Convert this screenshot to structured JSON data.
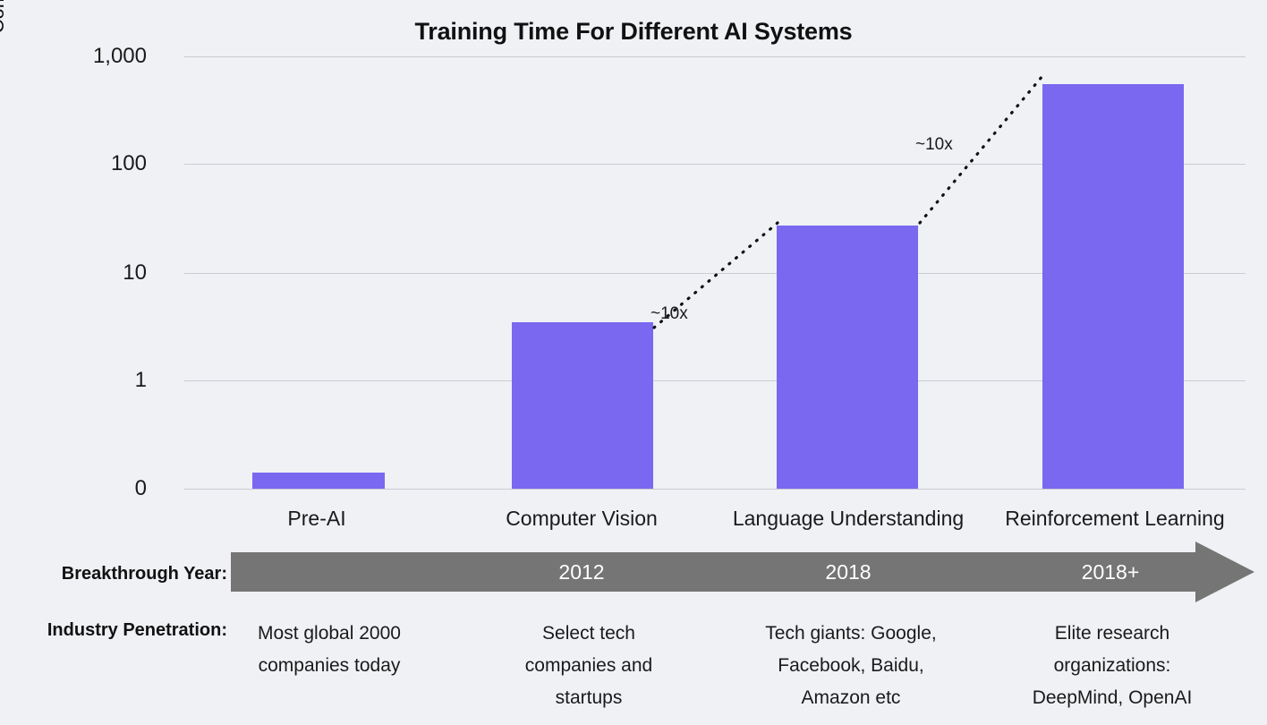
{
  "chart_data": {
    "type": "bar",
    "title": "Training Time For Different AI Systems",
    "xlabel": "",
    "ylabel": "Compute Time (petaflop days)",
    "yscale": "log-like",
    "ylim": [
      0,
      1000
    ],
    "grid": true,
    "legend": "none",
    "categories": [
      "Pre-AI",
      "Computer Vision",
      "Language Understanding",
      "Reinforcement Learning"
    ],
    "values": [
      0.02,
      3.5,
      27,
      550
    ],
    "ytick_labels": [
      "1,000",
      "100",
      "10",
      "1",
      "0"
    ],
    "ytick_values": [
      1000,
      100,
      10,
      1,
      0
    ],
    "bar_color": "#7a68f0",
    "annotations": [
      {
        "label": "~10x",
        "from_category": "Computer Vision",
        "to_category": "Language Understanding"
      },
      {
        "label": "~10x",
        "from_category": "Language Understanding",
        "to_category": "Reinforcement Learning"
      }
    ]
  },
  "rows": {
    "breakthrough_year": {
      "label": "Breakthrough Year:",
      "values": [
        "",
        "2012",
        "2018",
        "2018+"
      ],
      "band_color": "#757575"
    },
    "industry_penetration": {
      "label": "Industry Penetration:",
      "values": [
        [
          "Most global 2000",
          "companies today"
        ],
        [
          "Select tech",
          "companies and",
          "startups"
        ],
        [
          "Tech giants: Google,",
          "Facebook, Baidu,",
          "Amazon etc"
        ],
        [
          "Elite research",
          "organizations:",
          "DeepMind, OpenAI"
        ]
      ]
    }
  },
  "theme": {
    "background": "#eff1f5",
    "gridline": "#c9ccd2",
    "text": "#1a1a1a",
    "accent": "#7a68f0",
    "band": "#757575"
  }
}
